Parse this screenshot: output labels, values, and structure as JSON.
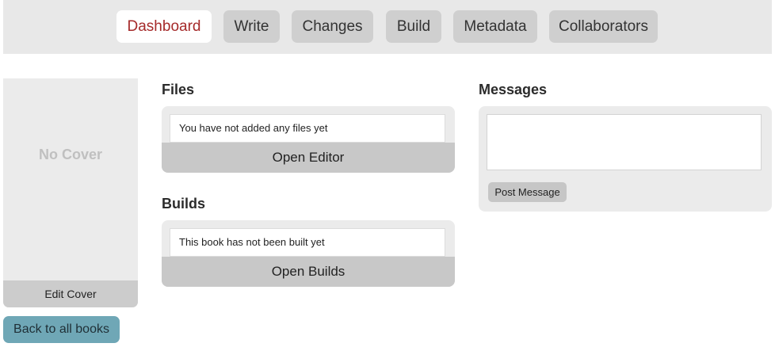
{
  "nav": {
    "tabs": [
      {
        "label": "Dashboard",
        "active": true
      },
      {
        "label": "Write",
        "active": false
      },
      {
        "label": "Changes",
        "active": false
      },
      {
        "label": "Build",
        "active": false
      },
      {
        "label": "Metadata",
        "active": false
      },
      {
        "label": "Collaborators",
        "active": false
      }
    ]
  },
  "cover": {
    "placeholder": "No Cover",
    "edit_label": "Edit Cover"
  },
  "back_label": "Back to all books",
  "files": {
    "title": "Files",
    "empty_text": "You have not added any files yet",
    "action_label": "Open Editor"
  },
  "builds": {
    "title": "Builds",
    "empty_text": "This book has not been built yet",
    "action_label": "Open Builds"
  },
  "messages": {
    "title": "Messages",
    "input_value": "",
    "post_label": "Post Message"
  },
  "colors": {
    "active_tab_text": "#a52a2a",
    "back_button": "#6fa7b6"
  }
}
